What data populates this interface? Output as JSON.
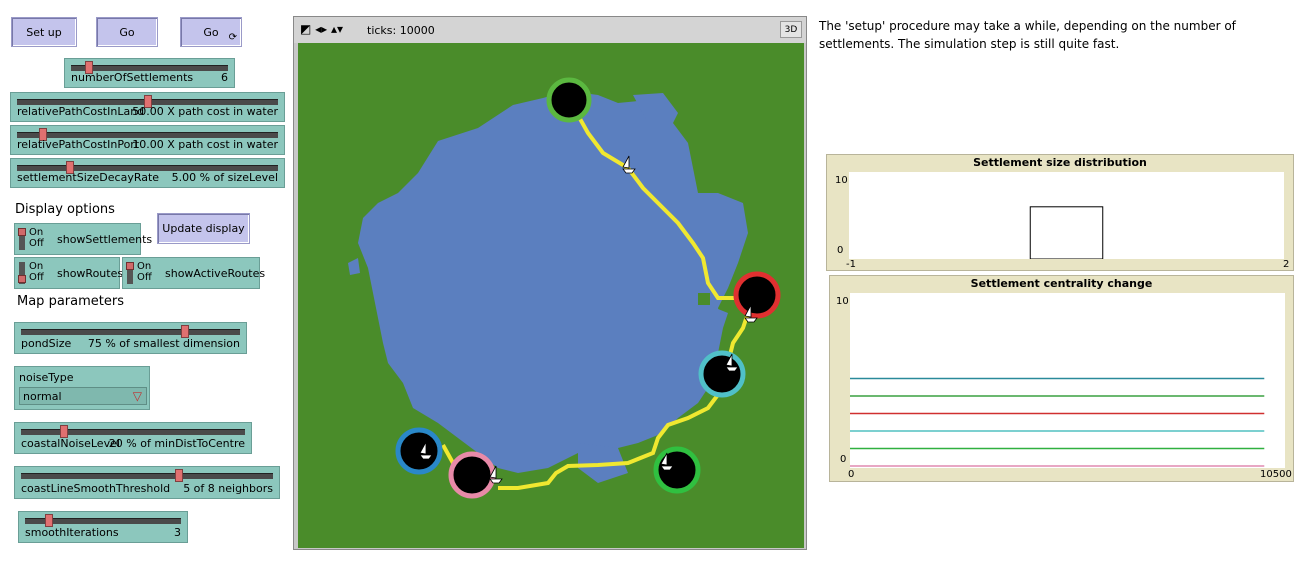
{
  "buttons": {
    "setup": "Set up",
    "go": "Go",
    "go_forever": "Go",
    "update_display": "Update display"
  },
  "sliders": {
    "numberOfSettlements": {
      "label": "numberOfSettlements",
      "value": "6",
      "fraction": 0.12
    },
    "relativePathCostInLand": {
      "label": "relativePathCostInLand",
      "value": "50.00 X path cost in water",
      "fraction": 0.5
    },
    "relativePathCostInPort": {
      "label": "relativePathCostInPort",
      "value": "10.00 X path cost in water",
      "fraction": 0.08
    },
    "settlementSizeDecayRate": {
      "label": "settlementSizeDecayRate",
      "value": "5.00 % of sizeLevel",
      "fraction": 0.18
    },
    "pondSize": {
      "label": "pondSize",
      "value": "75 % of smallest dimension",
      "fraction": 0.75
    },
    "coastalNoiseLevel": {
      "label": "coastalNoiseLevel",
      "value": "20 % of minDistToCentre",
      "fraction": 0.2
    },
    "coastLineSmoothThreshold": {
      "label": "coastLineSmoothThreshold",
      "value": "5 of 8 neighbors",
      "fraction": 0.62
    },
    "smoothIterations": {
      "label": "smoothIterations",
      "value": "3",
      "fraction": 0.15
    }
  },
  "display_options": {
    "heading": "Display options",
    "on": "On",
    "off": "Off",
    "showSettlements": "showSettlements",
    "showRoutes": "showRoutes",
    "showActiveRoutes": "showActiveRoutes"
  },
  "map_parameters": {
    "heading": "Map parameters"
  },
  "chooser": {
    "label": "noiseType",
    "value": "normal"
  },
  "view": {
    "ticks_label": "ticks: 10000",
    "btn_3d": "3D"
  },
  "info_text": "The 'setup' procedure may take a while, depending on the number of settlements. The simulation step is still quite fast.",
  "colors": {
    "land": "#4a8c2a",
    "water": "#5b7fbf",
    "route": "#f0e830",
    "button": "#c4c4ec",
    "widget": "#8cc7bd",
    "plot_bg": "#e8e4c4"
  },
  "chart_data": [
    {
      "type": "bar",
      "title": "Settlement size distribution",
      "xlim": [
        -1,
        2
      ],
      "ylim": [
        0,
        10
      ],
      "x_tick_labels": [
        "-1",
        "2"
      ],
      "y_tick_labels": [
        "10",
        "0"
      ],
      "categories": [
        "1"
      ],
      "values": [
        6
      ]
    },
    {
      "type": "line",
      "title": "Settlement centrality change",
      "xlim": [
        0,
        10500
      ],
      "ylim": [
        0,
        10
      ],
      "x_tick_labels": [
        "0",
        "10500"
      ],
      "y_tick_labels": [
        "10",
        "0"
      ],
      "series": [
        {
          "color": "#2a8a9a",
          "values": [
            5,
            5
          ]
        },
        {
          "color": "#3aa040",
          "values": [
            4,
            4
          ]
        },
        {
          "color": "#d03030",
          "values": [
            3,
            3
          ]
        },
        {
          "color": "#50c0c0",
          "values": [
            2,
            2
          ]
        },
        {
          "color": "#30b040",
          "values": [
            1,
            1
          ]
        },
        {
          "color": "#e08ab0",
          "values": [
            0,
            0
          ]
        }
      ],
      "x": [
        0,
        10000
      ]
    }
  ]
}
